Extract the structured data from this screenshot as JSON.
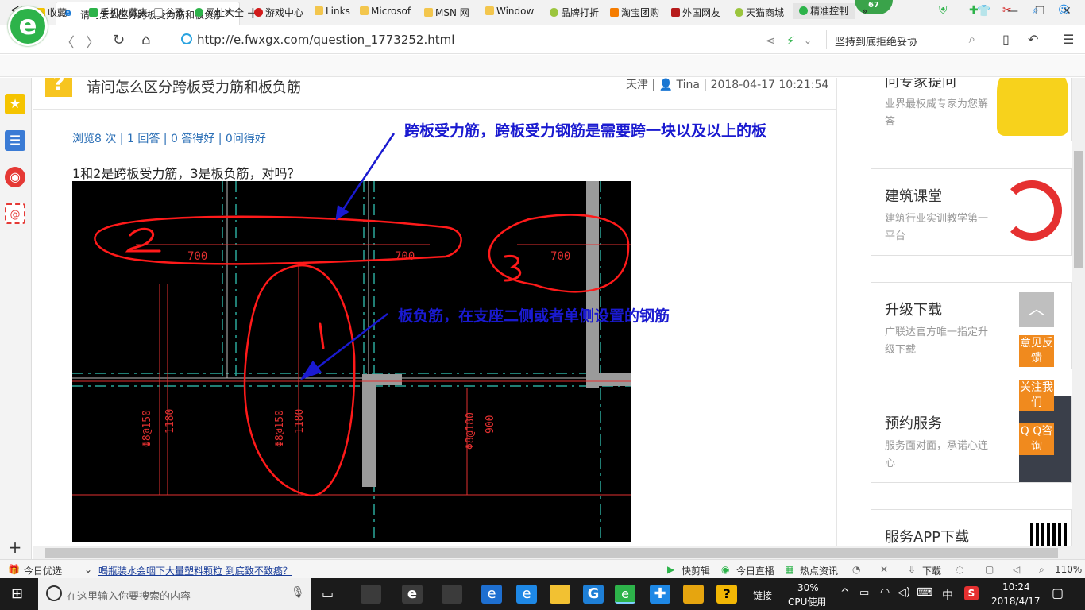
{
  "browser": {
    "tab_title": "请问怎么区分跨板受力筋和板负筋",
    "badge": "67",
    "url": "http://e.fwxgx.com/question_1773252.html",
    "search_text": "坚持到底拒绝妥协"
  },
  "bookmarks": [
    "收藏",
    "手机收藏夹",
    "谷歌",
    "网址大全",
    "游戏中心",
    "Links",
    "Microsof",
    "MSN 网",
    "Window",
    "品牌打折",
    "淘宝团购",
    "外国网友",
    "天猫商城",
    "精准控制"
  ],
  "question": {
    "title": "请问怎么区分跨板受力筋和板负筋",
    "meta": "天津 | 👤 Tina | 2018-04-17 10:21:54",
    "stats": "浏览8 次 | 1 回答 | 0 答得好 | 0问得好",
    "body": "1和2是跨板受力筋，3是板负筋，对吗？"
  },
  "drawing": {
    "annotation_top": "跨板受力筋，跨板受力钢筋是需要跨一块以及以上的板",
    "annotation_mid": "板负筋，在支座二侧或者单侧设置的钢筋",
    "labels": [
      "2",
      "3",
      "1",
      "700",
      "700",
      "700",
      "Φ8@150",
      "1180",
      "Φ8@150",
      "1180",
      "Φ8@180",
      "900"
    ]
  },
  "sidebar_cards": [
    {
      "title": "问专家提问",
      "desc": "业界最权威专家为您解答"
    },
    {
      "title": "建筑课堂",
      "desc": "建筑行业实训教学第一平台"
    },
    {
      "title": "升级下载",
      "desc": "广联达官方唯一指定升级下载"
    },
    {
      "title": "预约服务",
      "desc": "服务面对面，承诺心连心"
    },
    {
      "title": "服务APP下载",
      "desc": ""
    }
  ],
  "float_tabs": [
    "意见反馈",
    "关注我们",
    "Q Q咨询"
  ],
  "statusbar": {
    "today": "今日优选",
    "news": "喝瓶装水会咽下大量塑料颗粒 到底致不致癌？",
    "items": [
      "快剪辑",
      "今日直播",
      "热点资讯",
      "下载"
    ],
    "zoom": "110%"
  },
  "taskbar": {
    "search_placeholder": "在这里输入你要搜索的内容",
    "link": "链接",
    "cpu": "30%",
    "cpu_label": "CPU使用",
    "ime": "中",
    "time": "10:24",
    "date": "2018/4/17"
  },
  "colors": {
    "accent": "#2db34a",
    "link": "#2b6fb6",
    "annotation": "#1a1ad0",
    "markup": "#ff2020",
    "float": "#f08a1e"
  }
}
